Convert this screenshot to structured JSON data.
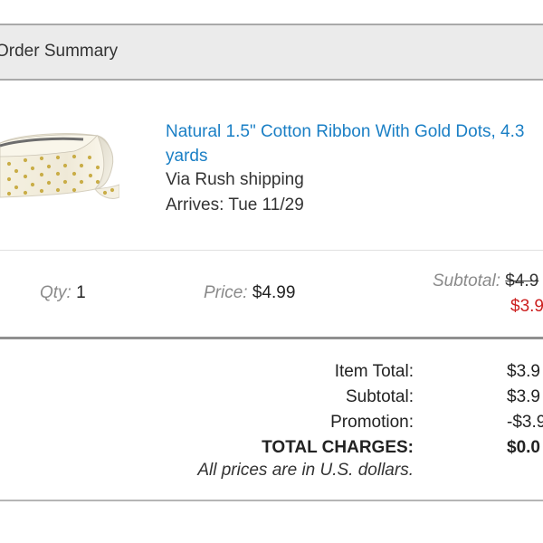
{
  "header": {
    "title": "Order Summary"
  },
  "product": {
    "title": "Natural 1.5\" Cotton Ribbon With Gold Dots, 4.3 yards",
    "shipping": "Via Rush shipping",
    "arrives": "Arrives: Tue 11/29",
    "image_icon": "ribbon-spool-icon"
  },
  "line_item": {
    "qty_label": "Qty:",
    "qty_value": "1",
    "price_label": "Price:",
    "price_value": "$4.99",
    "subtotal_label": "Subtotal:",
    "subtotal_original": "$4.9",
    "subtotal_discounted": "$3.9"
  },
  "totals": {
    "rows": [
      {
        "label": "Item Total:",
        "value": "$3.9"
      },
      {
        "label": "Subtotal:",
        "value": "$3.9"
      },
      {
        "label": "Promotion:",
        "value": "-$3.9"
      },
      {
        "label": "TOTAL CHARGES:",
        "value": "$0.0"
      }
    ],
    "note": "All prices are in U.S. dollars."
  },
  "colors": {
    "link": "#1a7fc5",
    "sale": "#cc1f1f",
    "header_bg": "#ebebeb"
  }
}
